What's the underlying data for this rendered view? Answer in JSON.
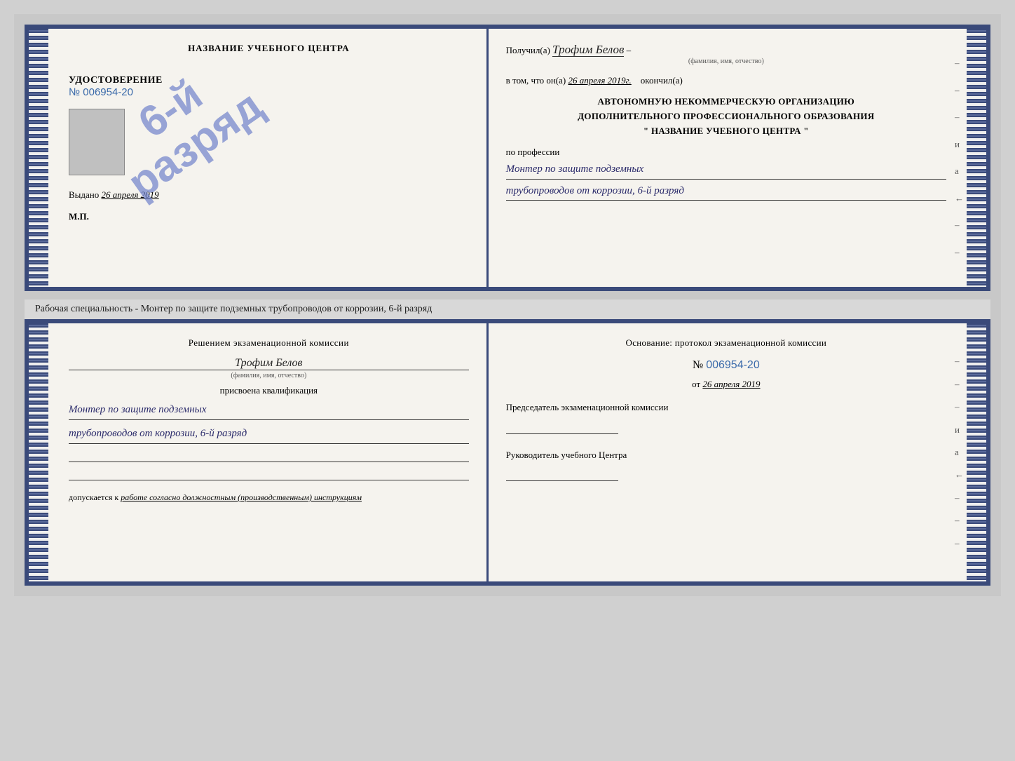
{
  "top_cert": {
    "left": {
      "title": "НАЗВАНИЕ УЧЕБНОГО ЦЕНТРА",
      "stamp_line1": "6-й",
      "stamp_line2": "разряд",
      "udost_label": "УДОСТОВЕРЕНИЕ",
      "udost_number": "№ 006954-20",
      "vydano_label": "Выдано",
      "vydano_date": "26 апреля 2019",
      "mp": "М.П."
    },
    "right": {
      "poluchil_label": "Получил(а)",
      "poluchil_name": "Трофим Белов",
      "fio_label": "(фамилия, имя, отчество)",
      "dash": "–",
      "vtom_label": "в том, что он(а)",
      "vtom_date": "26 апреля 2019г.",
      "okonchil": "окончил(а)",
      "org_line1": "АВТОНОМНУЮ НЕКОММЕРЧЕСКУЮ ОРГАНИЗАЦИЮ",
      "org_line2": "ДОПОЛНИТЕЛЬНОГО ПРОФЕССИОНАЛЬНОГО ОБРАЗОВАНИЯ",
      "org_line3": "\"    НАЗВАНИЕ УЧЕБНОГО ЦЕНТРА    \"",
      "po_professii": "по профессии",
      "profession_line1": "Монтер по защите подземных",
      "profession_line2": "трубопроводов от коррозии, 6-й разряд",
      "side_dashes": [
        "-",
        "-",
        "-",
        "и",
        "а",
        "←",
        "-",
        "-"
      ]
    }
  },
  "separator": {
    "text": "Рабочая специальность - Монтер по защите подземных трубопроводов от коррозии, 6-й разряд"
  },
  "bottom_cert": {
    "left": {
      "reshen_title": "Решением экзаменационной комиссии",
      "name": "Трофим Белов",
      "fio_label": "(фамилия, имя, отчество)",
      "prisvoena": "присвоена квалификация",
      "kvalif_line1": "Монтер по защите подземных",
      "kvalif_line2": "трубопроводов от коррозии, 6-й разряд",
      "dopusk_pre": "допускается к",
      "dopusk_cursive": "работе согласно должностным (производственным) инструкциям"
    },
    "right": {
      "osnovanie": "Основание: протокол экзаменационной комиссии",
      "number_label": "№",
      "number_value": "006954-20",
      "ot_label": "от",
      "ot_date": "26 апреля 2019",
      "predsedatel_label": "Председатель экзаменационной комиссии",
      "rukovoditel_label": "Руководитель учебного Центра",
      "side_dashes": [
        "-",
        "-",
        "-",
        "и",
        "а",
        "←",
        "-",
        "-",
        "-"
      ]
    }
  }
}
